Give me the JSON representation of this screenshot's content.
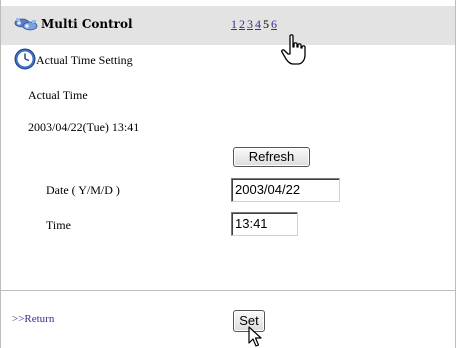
{
  "header": {
    "title": "Multi Control",
    "pages": [
      "1",
      "2",
      "3",
      "4",
      "5",
      "6"
    ],
    "current_page": "5"
  },
  "section": {
    "title": "Actual Time Setting",
    "actual_time_label": "Actual Time",
    "actual_time_value": "2003/04/22(Tue) 13:41"
  },
  "refresh_label": "Refresh",
  "form": {
    "date_label": "Date ( Y/M/D )",
    "date_value": "2003/04/22",
    "time_label": "Time",
    "time_value": "13:41"
  },
  "footer": {
    "return_label": ">>Return",
    "set_label": "Set"
  },
  "icons": {
    "logo": "multi-projector-icon",
    "section": "clock-icon",
    "cursor_hand": "hand-pointer-icon",
    "cursor_arrow": "arrow-pointer-icon"
  },
  "colors": {
    "header_bg": "#e3e3e3",
    "link": "#3b2f8f"
  }
}
